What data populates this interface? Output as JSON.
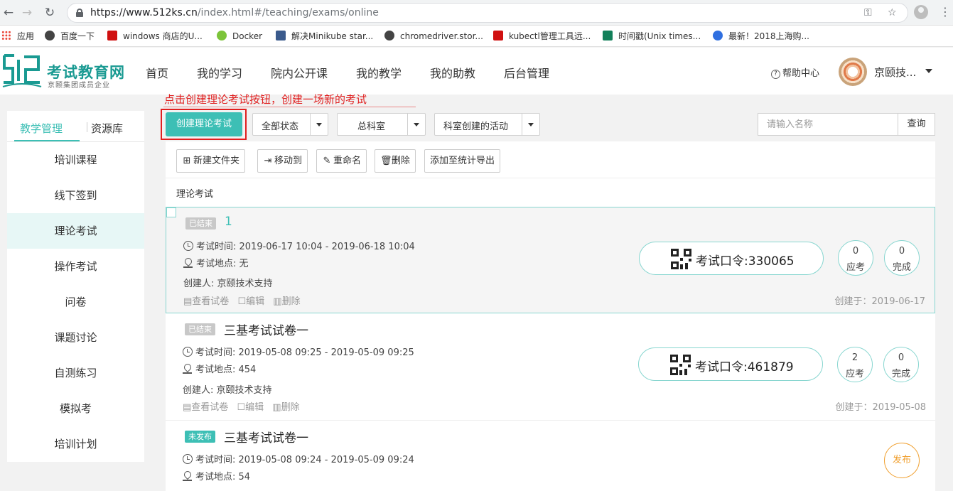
{
  "browser": {
    "url_host": "https://www.512ks.cn",
    "url_path": "/index.html#/teaching/exams/online",
    "bookmarks": [
      {
        "label": "应用",
        "icon": "apps-grid-icon"
      },
      {
        "label": "百度一下",
        "icon": "globe-icon"
      },
      {
        "label": "windows 商店的U...",
        "icon": "red-c-icon"
      },
      {
        "label": "Docker",
        "icon": "green-chat-icon"
      },
      {
        "label": "解决Minikube star...",
        "icon": "blue-g-icon"
      },
      {
        "label": "chromedriver.stor...",
        "icon": "globe-icon"
      },
      {
        "label": "kubectl管理工具远...",
        "icon": "red-c-icon"
      },
      {
        "label": "时间戳(Unix times...",
        "icon": "green-t-icon"
      },
      {
        "label": "最新！2018上海购...",
        "icon": "baidu-paw-icon"
      }
    ]
  },
  "site": {
    "logo_title": "考试教育网",
    "logo_subtitle": "京颐集团成员企业",
    "nav": [
      "首页",
      "我的学习",
      "院内公开课",
      "我的教学",
      "我的助教",
      "后台管理"
    ],
    "help": "帮助中心",
    "user_name": "京颐技..."
  },
  "sidebar": {
    "tabs": [
      "教学管理",
      "资源库"
    ],
    "items": [
      "培训课程",
      "线下签到",
      "理论考试",
      "操作考试",
      "问卷",
      "课题讨论",
      "自测练习",
      "模拟考",
      "培训计划"
    ],
    "active_index": 2
  },
  "main": {
    "annotation": "点击创建理论考试按钮，创建一场新的考试",
    "create_button": "创建理论考试",
    "filters": [
      "全部状态",
      "总科室",
      "科室创建的活动"
    ],
    "search_placeholder": "请输入名称",
    "search_button": "查询",
    "toolbar": [
      "新建文件夹",
      "移动到",
      "重命名",
      "删除",
      "添加至统计导出"
    ],
    "section_title": "理论考试"
  },
  "exams": [
    {
      "status": "已结束",
      "title": "1",
      "time": "考试时间: 2019-06-17 10:04 - 2019-06-18 10:04",
      "location": "考试地点: 无",
      "creator": "创建人: 京颐技术支持",
      "actions": [
        "查看试卷",
        "编辑",
        "删除"
      ],
      "code": "考试口令:330065",
      "expected": "0",
      "expected_label": "应考",
      "completed": "0",
      "completed_label": "完成",
      "created": "创建于：2019-06-17"
    },
    {
      "status": "已结束",
      "title": "三基考试试卷一",
      "time": "考试时间: 2019-05-08 09:25 - 2019-05-09 09:25",
      "location": "考试地点: 454",
      "creator": "创建人: 京颐技术支持",
      "actions": [
        "查看试卷",
        "编辑",
        "删除"
      ],
      "code": "考试口令:461879",
      "expected": "2",
      "expected_label": "应考",
      "completed": "0",
      "completed_label": "完成",
      "created": "创建于：2019-05-08"
    },
    {
      "status": "未发布",
      "title": "三基考试试卷一",
      "time": "考试时间: 2019-05-08 09:24 - 2019-05-09 09:24",
      "location": "考试地点: 54",
      "publish": "发布"
    }
  ],
  "colors": {
    "accent": "#3dbfb5",
    "annotation": "#e02020",
    "publish": "#f0a030"
  }
}
